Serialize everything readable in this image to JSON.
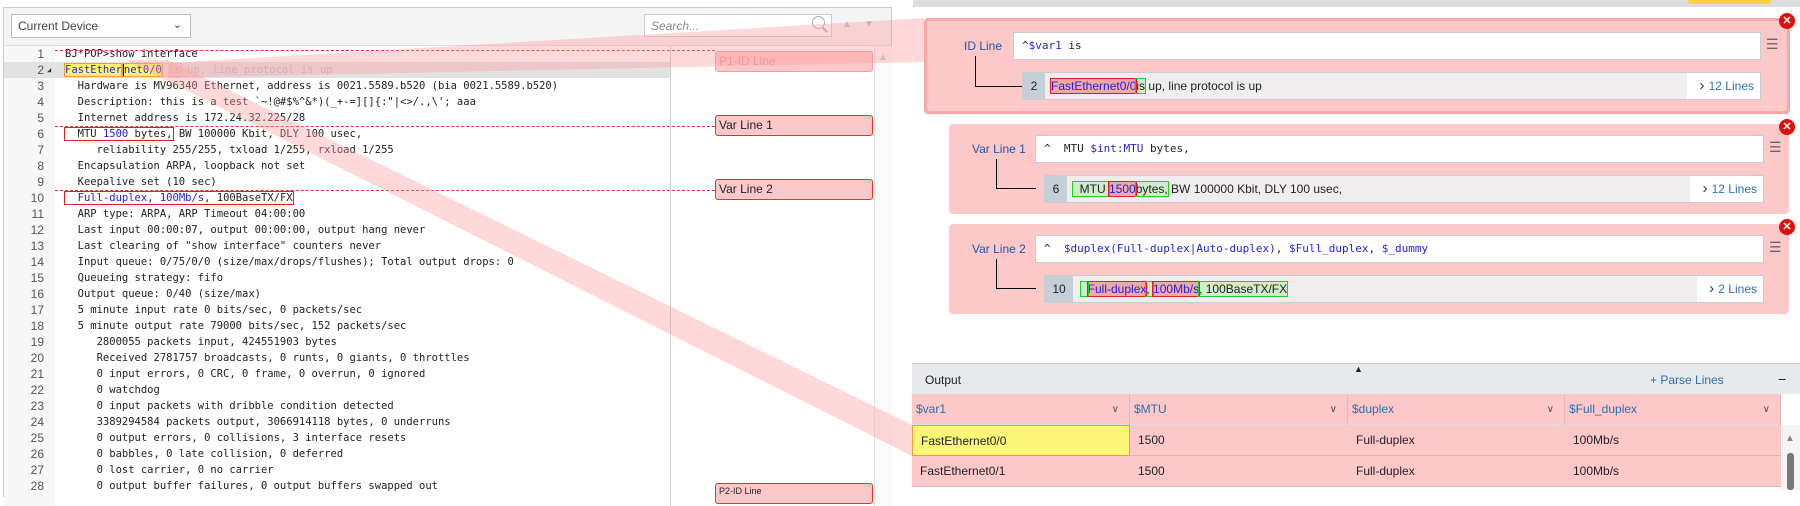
{
  "toolbar": {
    "device_select": "Current Device",
    "search_placeholder": "Search...",
    "icons": [
      "chevron-down-icon",
      "search-icon",
      "arrow-up-icon",
      "arrow-down-icon"
    ]
  },
  "code": {
    "lines": [
      "BJ*POP>show interface",
      [
        {
          "t": "FastEther",
          "k": "hl"
        },
        {
          "t": "net0/0",
          "k": "hl2"
        },
        {
          "t": " is",
          "k": "fadebox"
        },
        {
          "t": " up, line protocol is up",
          "k": "fade"
        }
      ],
      "  Hardware is MV96340 Ethernet, address is 0021.5589.b520 (bia 0021.5589.b520)",
      "  Description: this is a test `~!@#$%^&*)(_+-=][]{:\"|<>/.,\\'; aaa",
      "  Internet address is 172.24.32.225/28",
      [
        {
          "t": "  MTU ",
          "k": "boxstart"
        },
        {
          "t": "1500",
          "k": "varin"
        },
        {
          "t": " bytes,",
          "k": "boxend"
        },
        {
          "t": " BW 100000 Kbit, DLY 100 usec,",
          "k": ""
        }
      ],
      "     reliability 255/255, txload 1/255, rxload 1/255",
      "  Encapsulation ARPA, loopback not set",
      "  Keepalive set (10 sec)",
      [
        {
          "t": "  ",
          "k": "boxstart"
        },
        {
          "t": "Full-duplex",
          "k": "varin"
        },
        {
          "t": ", ",
          "k": "in"
        },
        {
          "t": "100Mb/s",
          "k": "varin"
        },
        {
          "t": ", 100BaseTX/FX",
          "k": "boxend"
        }
      ],
      "  ARP type: ARPA, ARP Timeout 04:00:00",
      "  Last input 00:00:07, output 00:00:00, output hang never",
      "  Last clearing of \"show interface\" counters never",
      "  Input queue: 0/75/0/0 (size/max/drops/flushes); Total output drops: 0",
      "  Queueing strategy: fifo",
      "  Output queue: 0/40 (size/max)",
      "  5 minute input rate 0 bits/sec, 0 packets/sec",
      "  5 minute output rate 79000 bits/sec, 152 packets/sec",
      "     2800055 packets input, 424551903 bytes",
      "     Received 2781757 broadcasts, 0 runts, 0 giants, 0 throttles",
      "     0 input errors, 0 CRC, 0 frame, 0 overrun, 0 ignored",
      "     0 watchdog",
      "     0 input packets with dribble condition detected",
      "     3389294584 packets output, 3066914118 bytes, 0 underruns",
      "     0 output errors, 0 collisions, 3 interface resets",
      "     0 babbles, 0 late collision, 0 deferred",
      "     0 lost carrier, 0 no carrier",
      "     0 output buffer failures, 0 output buffers swapped out"
    ]
  },
  "markers": {
    "id": "P1-ID Line",
    "var1": "Var Line 1",
    "var2": "Var Line 2",
    "next": "P2-ID Line"
  },
  "cards": {
    "id": {
      "label": "ID Line",
      "regex": [
        {
          "t": "^"
        },
        {
          "t": "$var1",
          "v": 1
        },
        {
          "t": " is"
        }
      ],
      "line_no": "2",
      "sample": [
        {
          "t": "FastEthernet0/0",
          "k": "r"
        },
        {
          "t": "is",
          "k": "g"
        },
        {
          "t": " up, line protocol is up"
        }
      ],
      "more": "12 Lines"
    },
    "var1": {
      "label": "Var Line 1",
      "regex": [
        {
          "t": "^  MTU "
        },
        {
          "t": "$int:MTU",
          "v": 1
        },
        {
          "t": " bytes,"
        }
      ],
      "line_no": "6",
      "sample": [
        {
          "t": "  MTU ",
          "k": "g"
        },
        {
          "t": "1500",
          "k": "r"
        },
        {
          "t": "bytes,",
          "k": "g"
        },
        {
          "t": " BW 100000 Kbit, DLY 100 usec,"
        }
      ],
      "more": "12 Lines"
    },
    "var2": {
      "label": "Var Line 2",
      "regex": [
        {
          "t": "^  "
        },
        {
          "t": "$duplex(Full-duplex|Auto-duplex)",
          "v": 1
        },
        {
          "t": ", "
        },
        {
          "t": "$Full_duplex",
          "v": 1
        },
        {
          "t": ", "
        },
        {
          "t": "$_dummy",
          "v": 1
        }
      ],
      "line_no": "10",
      "sample": [
        {
          "t": "  ",
          "k": "g"
        },
        {
          "t": "Full-duplex",
          "k": "r"
        },
        {
          "t": ", ",
          "k": "g"
        },
        {
          "t": "100Mb/s",
          "k": "r"
        },
        {
          "t": ", 100BaseTX/FX",
          "k": "g"
        }
      ],
      "more": "2 Lines"
    }
  },
  "output": {
    "title": "Output",
    "parse_lines": "+ Parse Lines",
    "minimize": "−",
    "columns": [
      "$var1",
      "$MTU",
      "$duplex",
      "$Full_duplex"
    ],
    "rows": [
      [
        "FastEthernet0/0",
        "1500",
        "Full-duplex",
        "100Mb/s"
      ],
      [
        "FastEthernet0/1",
        "1500",
        "Full-duplex",
        "100Mb/s"
      ]
    ],
    "selected_cell": [
      0,
      0
    ]
  },
  "colors": {
    "card_bg": "#fcc8c8",
    "var_text": "#2222dd",
    "match_red": "#e02020",
    "match_green": "#20d020",
    "highlight": "#fff570",
    "link": "#2a6fb0"
  }
}
